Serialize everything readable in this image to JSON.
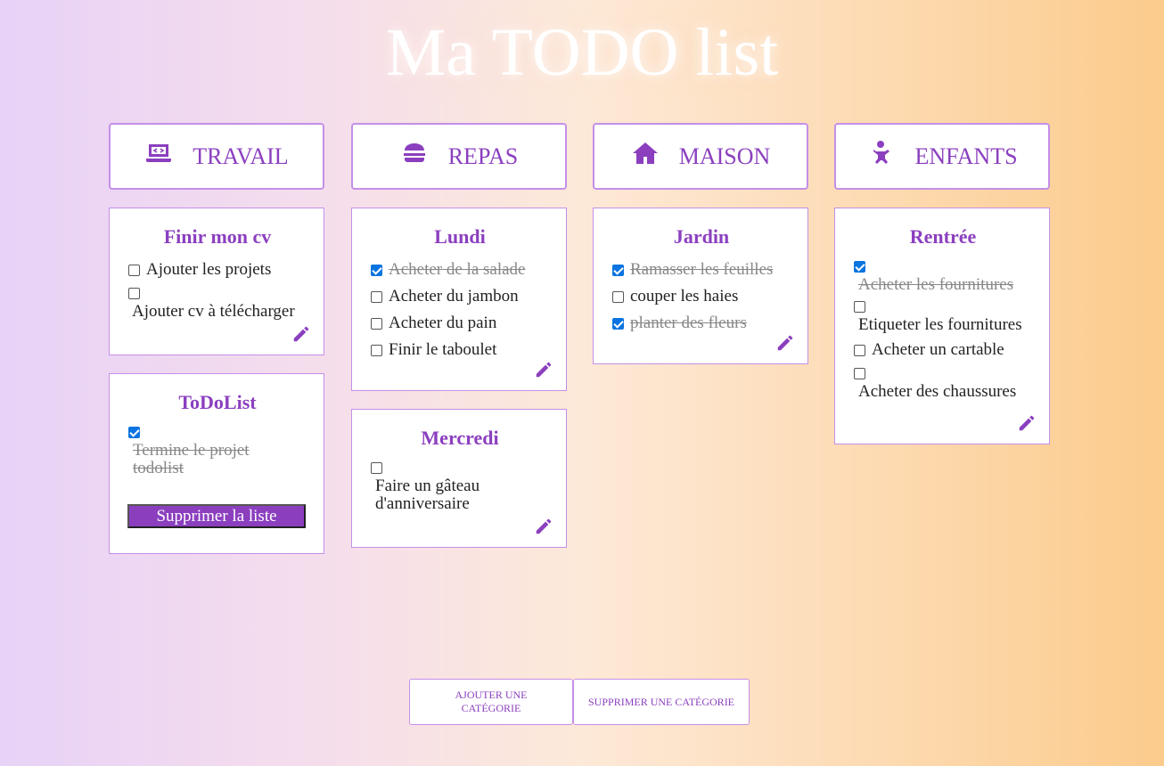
{
  "title": "Ma TODO list",
  "colors": {
    "accent": "#8b3fbf",
    "border": "#c48fe8",
    "checkbox": "#0b74e0"
  },
  "categories": [
    {
      "label": "TRAVAIL",
      "icon": "laptop-code-icon",
      "cards": [
        {
          "title": "Finir mon cv",
          "items": [
            {
              "text": "Ajouter les projets",
              "done": false
            },
            {
              "text": "Ajouter cv à télécharger",
              "done": false
            }
          ]
        },
        {
          "title": "ToDoList",
          "items": [
            {
              "text": "Termine le projet todolist",
              "done": true
            }
          ],
          "delete_label": "Supprimer la liste"
        }
      ]
    },
    {
      "label": "REPAS",
      "icon": "burger-icon",
      "cards": [
        {
          "title": "Lundi",
          "items": [
            {
              "text": "Acheter de la salade",
              "done": true
            },
            {
              "text": "Acheter du jambon",
              "done": false
            },
            {
              "text": "Acheter du pain",
              "done": false
            },
            {
              "text": "Finir le taboulet",
              "done": false
            }
          ]
        },
        {
          "title": "Mercredi",
          "items": [
            {
              "text": "Faire un gâteau d'anniversaire",
              "done": false
            }
          ]
        }
      ]
    },
    {
      "label": "MAISON",
      "icon": "house-icon",
      "cards": [
        {
          "title": "Jardin",
          "items": [
            {
              "text": "Ramasser les feuilles",
              "done": true
            },
            {
              "text": "couper les haies",
              "done": false
            },
            {
              "text": "planter des fleurs",
              "done": true
            }
          ]
        }
      ]
    },
    {
      "label": "ENFANTS",
      "icon": "baby-icon",
      "cards": [
        {
          "title": "Rentrée",
          "items": [
            {
              "text": "Acheter les fournitures",
              "done": true
            },
            {
              "text": "Etiqueter les fournitures",
              "done": false
            },
            {
              "text": "Acheter un cartable",
              "done": false
            },
            {
              "text": "Acheter des chaussures",
              "done": false
            }
          ]
        }
      ]
    }
  ],
  "footer": {
    "add_category": "AJOUTER UNE CATÉGORIE",
    "delete_category": "SUPPRIMER UNE CATÉGORIE"
  }
}
